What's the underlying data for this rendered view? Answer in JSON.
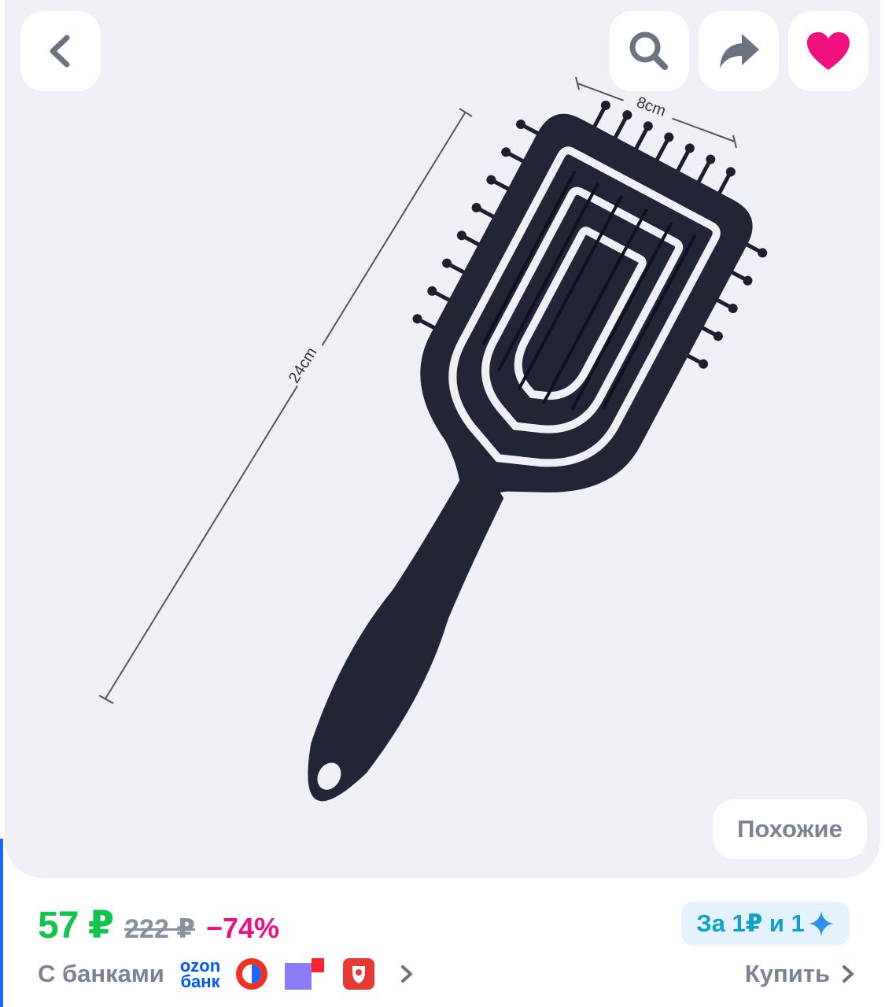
{
  "toolbar": {
    "back_icon": "chevron-left-icon",
    "search_icon": "search-icon",
    "share_icon": "share-icon",
    "favorite_icon": "heart-icon",
    "favorite_color": "#f1117e"
  },
  "product_image": {
    "dimension_width": "8cm",
    "dimension_length": "24cm"
  },
  "similar_button": {
    "label": "Похожие"
  },
  "price": {
    "current": "57 ₽",
    "old": "222 ₽",
    "discount": "−74%",
    "current_color": "#10c44c",
    "discount_color": "#f1117e"
  },
  "promo": {
    "label": "За 1₽ и 1",
    "icon": "sparkle-icon"
  },
  "banks": {
    "label": "С банками",
    "ozon_line1": "ozon",
    "ozon_line2": "банк"
  },
  "buy": {
    "label": "Купить"
  }
}
